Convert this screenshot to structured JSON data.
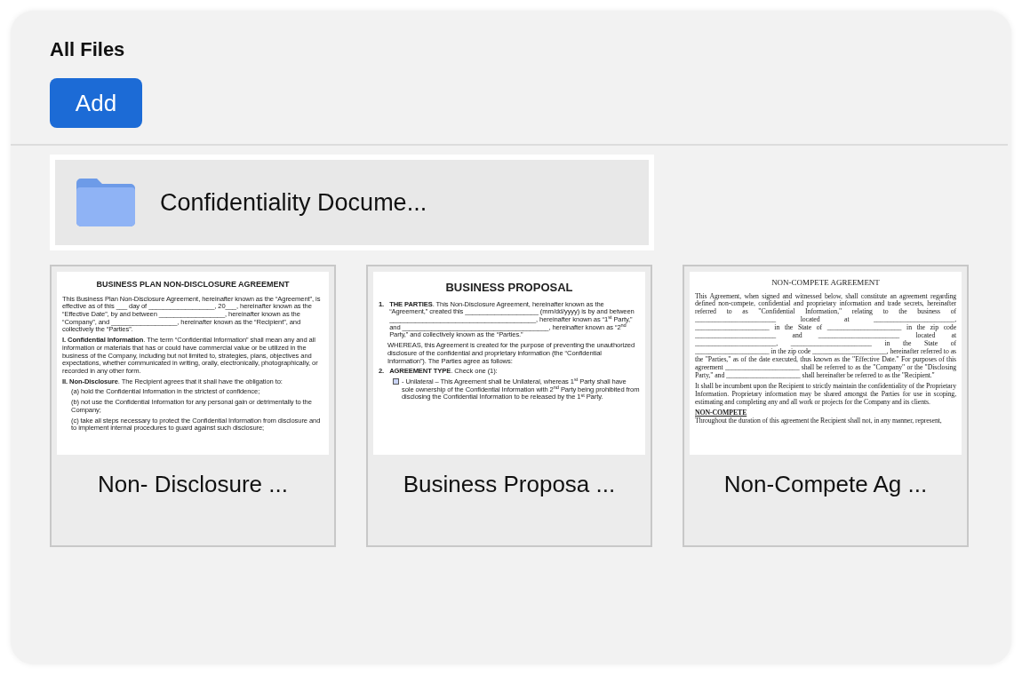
{
  "header": {
    "title": "All Files",
    "add_button": "Add"
  },
  "folders": [
    {
      "name": "Confidentiality Docume..."
    }
  ],
  "files": [
    {
      "name": "Non- Disclosure ...",
      "document": {
        "title": "BUSINESS PLAN NON-DISCLOSURE AGREEMENT",
        "paragraphs": [
          {
            "kind": "para",
            "text": "This Business Plan Non-Disclosure Agreement, hereinafter known as the “Agreement”, is effective as of this ___ day of __________________, 20___, hereinafter known as the “Effective Date”, by and between __________________, hereinafter known as the “Company”, and __________________, hereinafter known as the “Recipient”, and collectively the “Parties”."
          },
          {
            "kind": "para",
            "text": "**I. Confidential Information**. The term “Confidential Information” shall mean any and all information or materials that has or could have commercial value or be utilized in the business of the Company, including but not limited to, strategies, plans, objectives and expectations, whether communicated in writing, orally, electronically, photographically, or recorded in any other form."
          },
          {
            "kind": "para",
            "text": "**II. Non-Disclosure**. The Recipient agrees that it shall have the obligation to:"
          },
          {
            "kind": "indent",
            "text": "(a) hold the Confidential Information in the strictest of confidence;"
          },
          {
            "kind": "indent",
            "text": "(b) not use the Confidential Information for any personal gain or detrimentally to the Company;"
          },
          {
            "kind": "indent",
            "text": "(c) take all steps necessary to protect the Confidential Information from disclosure and to implement internal procedures to guard against such disclosure;"
          }
        ]
      }
    },
    {
      "name": "Business Proposa ...",
      "document": {
        "title": "BUSINESS PROPOSAL",
        "paragraphs": [
          {
            "kind": "numbered",
            "number": "1.",
            "text": "**THE PARTIES**. This Non-Disclosure Agreement, hereinafter known as the “Agreement,” created this ____________________ (mm/dd/yyyy) is by and between ________________________________________, hereinafter known as “1$^{st}$ Party,” and ________________________________________, hereinafter known as “2$^{nd}$ Party,” and collectively known as the “Parties.”"
          },
          {
            "kind": "indent",
            "text": "WHEREAS, this Agreement is created for the purpose of preventing the unauthorized disclosure of the confidential and proprietary information (the “Confidential Information”). The Parties agree as follows:"
          },
          {
            "kind": "numbered",
            "number": "2.",
            "text": "**AGREEMENT TYPE**. Check one (1):"
          },
          {
            "kind": "checkbox",
            "checked": false,
            "text": "- Unilateral – This Agreement shall be Unilateral, whereas 1$^{st}$ Party shall have sole ownership of the Confidential Information with 2$^{nd}$ Party being prohibited from disclosing the Confidential Information to be released by the 1$^{st}$ Party."
          }
        ]
      }
    },
    {
      "name": "Non-Compete Ag ...",
      "document": {
        "title": "NON-COMPETE AGREEMENT",
        "paragraphs": [
          {
            "kind": "para",
            "text": "This Agreement, when signed and witnessed below, shall constitute an agreement regarding defined non-compete, confidential and proprietary information and trade secrets, hereinafter referred to as \"Confidential Information,\" relating to the business of ________________________ located at ________________________, ______________________ in the State of ______________________ in the zip code ________________________ and ________________________ located at ________________________, ________________________ in the State of ______________________ in the zip code ______________________, hereinafter referred to as the \"Parties,\" as of the date executed, thus known as the \"Effective Date.\" For purposes of this agreement ______________________ shall be referred to as the \"Company\" or the \"Disclosing Party,\" and ______________________ shall hereinafter be referred to as the \"Recipient.\""
          },
          {
            "kind": "para",
            "text": "It shall be incumbent upon the Recipient to strictly maintain the confidentiality of the Proprietary Information. Proprietary information may be shared amongst the Parties for use in scoping, estimating and completing any and all work or projects for the Company and its clients."
          },
          {
            "kind": "heading",
            "text": "NON-COMPETE"
          },
          {
            "kind": "tight",
            "text": "Throughout the duration of this agreement the Recipient shall not, in any manner, represent,"
          }
        ]
      }
    }
  ]
}
